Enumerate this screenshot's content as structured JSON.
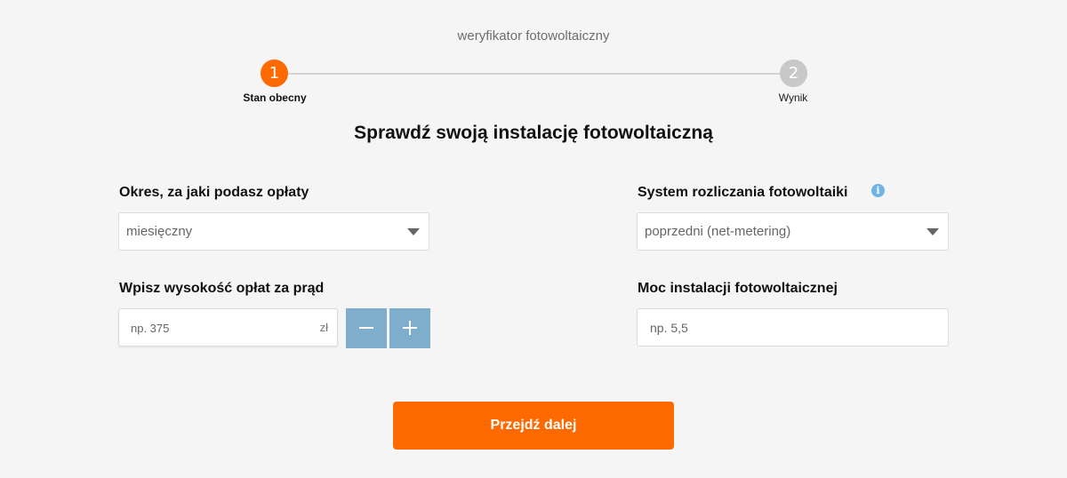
{
  "app": {
    "title": "weryfikator fotowoltaiczny"
  },
  "stepper": {
    "steps": [
      {
        "number": "1",
        "label": "Stan obecny",
        "active": true
      },
      {
        "number": "2",
        "label": "Wynik",
        "active": false
      }
    ]
  },
  "main": {
    "title": "Sprawdź swoją instalację fotowoltaiczną"
  },
  "form": {
    "period": {
      "label": "Okres, za jaki podasz opłaty",
      "value": "miesięczny"
    },
    "system": {
      "label": "System rozliczania fotowoltaiki",
      "value": "poprzedni (net-metering)",
      "info_icon": "i"
    },
    "fee": {
      "label": "Wpisz wysokość opłat za prąd",
      "placeholder": "np. 375",
      "unit": "zł"
    },
    "power": {
      "label": "Moc instalacji fotowoltaicznej",
      "placeholder": "np. 5,5"
    },
    "submit_label": "Przejdź dalej"
  },
  "colors": {
    "accent": "#ff6a00",
    "stepper_button": "#7eaecb",
    "info": "#6fb4e4"
  }
}
